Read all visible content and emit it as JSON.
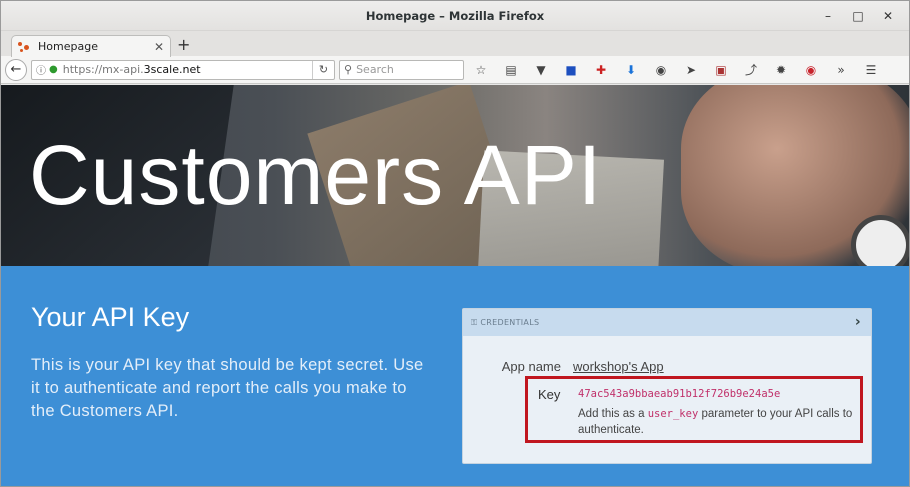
{
  "window": {
    "title": "Homepage – Mozilla Firefox",
    "controls": [
      "–",
      "□",
      "✕"
    ]
  },
  "tabs": [
    {
      "label": "Homepage",
      "close": "✕"
    }
  ],
  "new_tab_label": "+",
  "navbar": {
    "back": "←",
    "url_scheme": "https://mx-api.",
    "url_host": "3scale.net",
    "reload": "↻",
    "search_placeholder": "Search"
  },
  "toolbar_icons": [
    "star-icon",
    "reading-list-icon",
    "pocket-icon",
    "save-icon",
    "addon-icon",
    "download-icon",
    "screenshot-icon",
    "send-icon",
    "extension-icon",
    "pin-icon",
    "dev-icon",
    "pinterest-icon",
    "overflow-icon",
    "menu-icon"
  ],
  "hero": {
    "title": "Customers API"
  },
  "section": {
    "heading": "Your API Key",
    "text": "This is your API key that should be kept secret. Use it to authenticate and report the calls you make to the Customers API."
  },
  "credentials": {
    "header": "CREDENTIALS",
    "app_name_label": "App name",
    "app_name_value": "workshop's App",
    "key_label": "Key",
    "key_value": "47ac543a9bbaeab91b12f726b9e24a5e",
    "desc_before": "Add this as a",
    "desc_code": "user_key",
    "desc_after": "parameter to your API calls to authenticate."
  },
  "colors": {
    "hero_title": "#ffffff",
    "section_bg": "#3d8fd6",
    "highlight_border": "#c0161f",
    "code_color": "#c0306a"
  }
}
